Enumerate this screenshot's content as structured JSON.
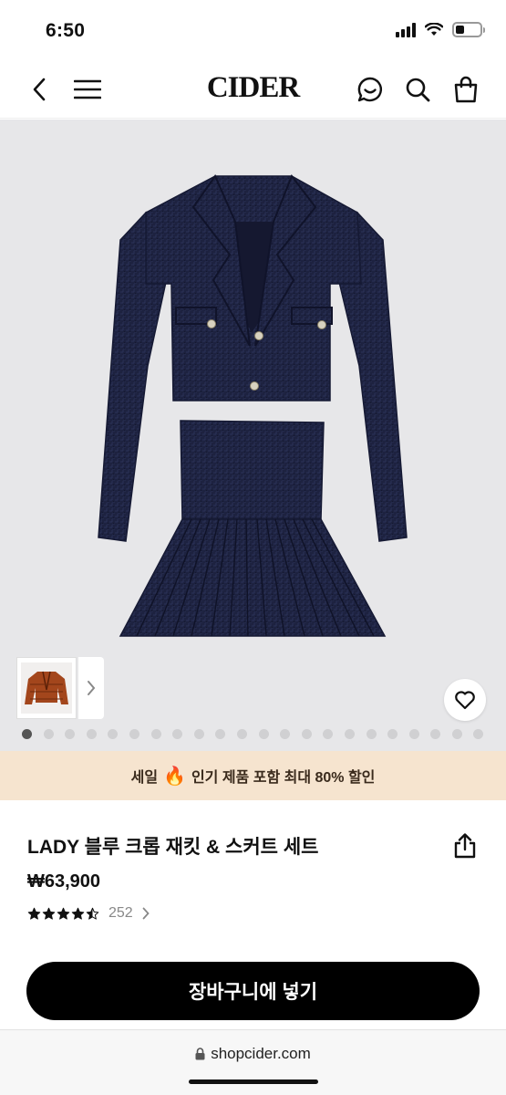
{
  "status_bar": {
    "time": "6:50",
    "battery_level": 0.25
  },
  "navbar": {
    "brand": "CIDER",
    "icons": [
      "back-icon",
      "menu-icon",
      "chat-icon",
      "search-icon",
      "bag-icon"
    ]
  },
  "gallery": {
    "image": "navy tweed cropped jacket and pleated skirt set",
    "thumbnail": "orange tweed jacket",
    "dot_count": 22,
    "active_dot": 0
  },
  "promo": {
    "prefix": "세일",
    "emoji": "🔥",
    "suffix": "인기 제품 포함 최대 80% 할인"
  },
  "product": {
    "title": "LADY 블루 크롭 재킷 & 스커트 세트",
    "price": "₩63,900",
    "rating": 4.5,
    "review_count": "252"
  },
  "cta": {
    "label": "장바구니에 넣기"
  },
  "browser": {
    "url": "shopcider.com"
  },
  "colors": {
    "accent": "#000000",
    "promo_bg": "#f6e4cf",
    "gallery_bg": "#e7e7e9"
  }
}
